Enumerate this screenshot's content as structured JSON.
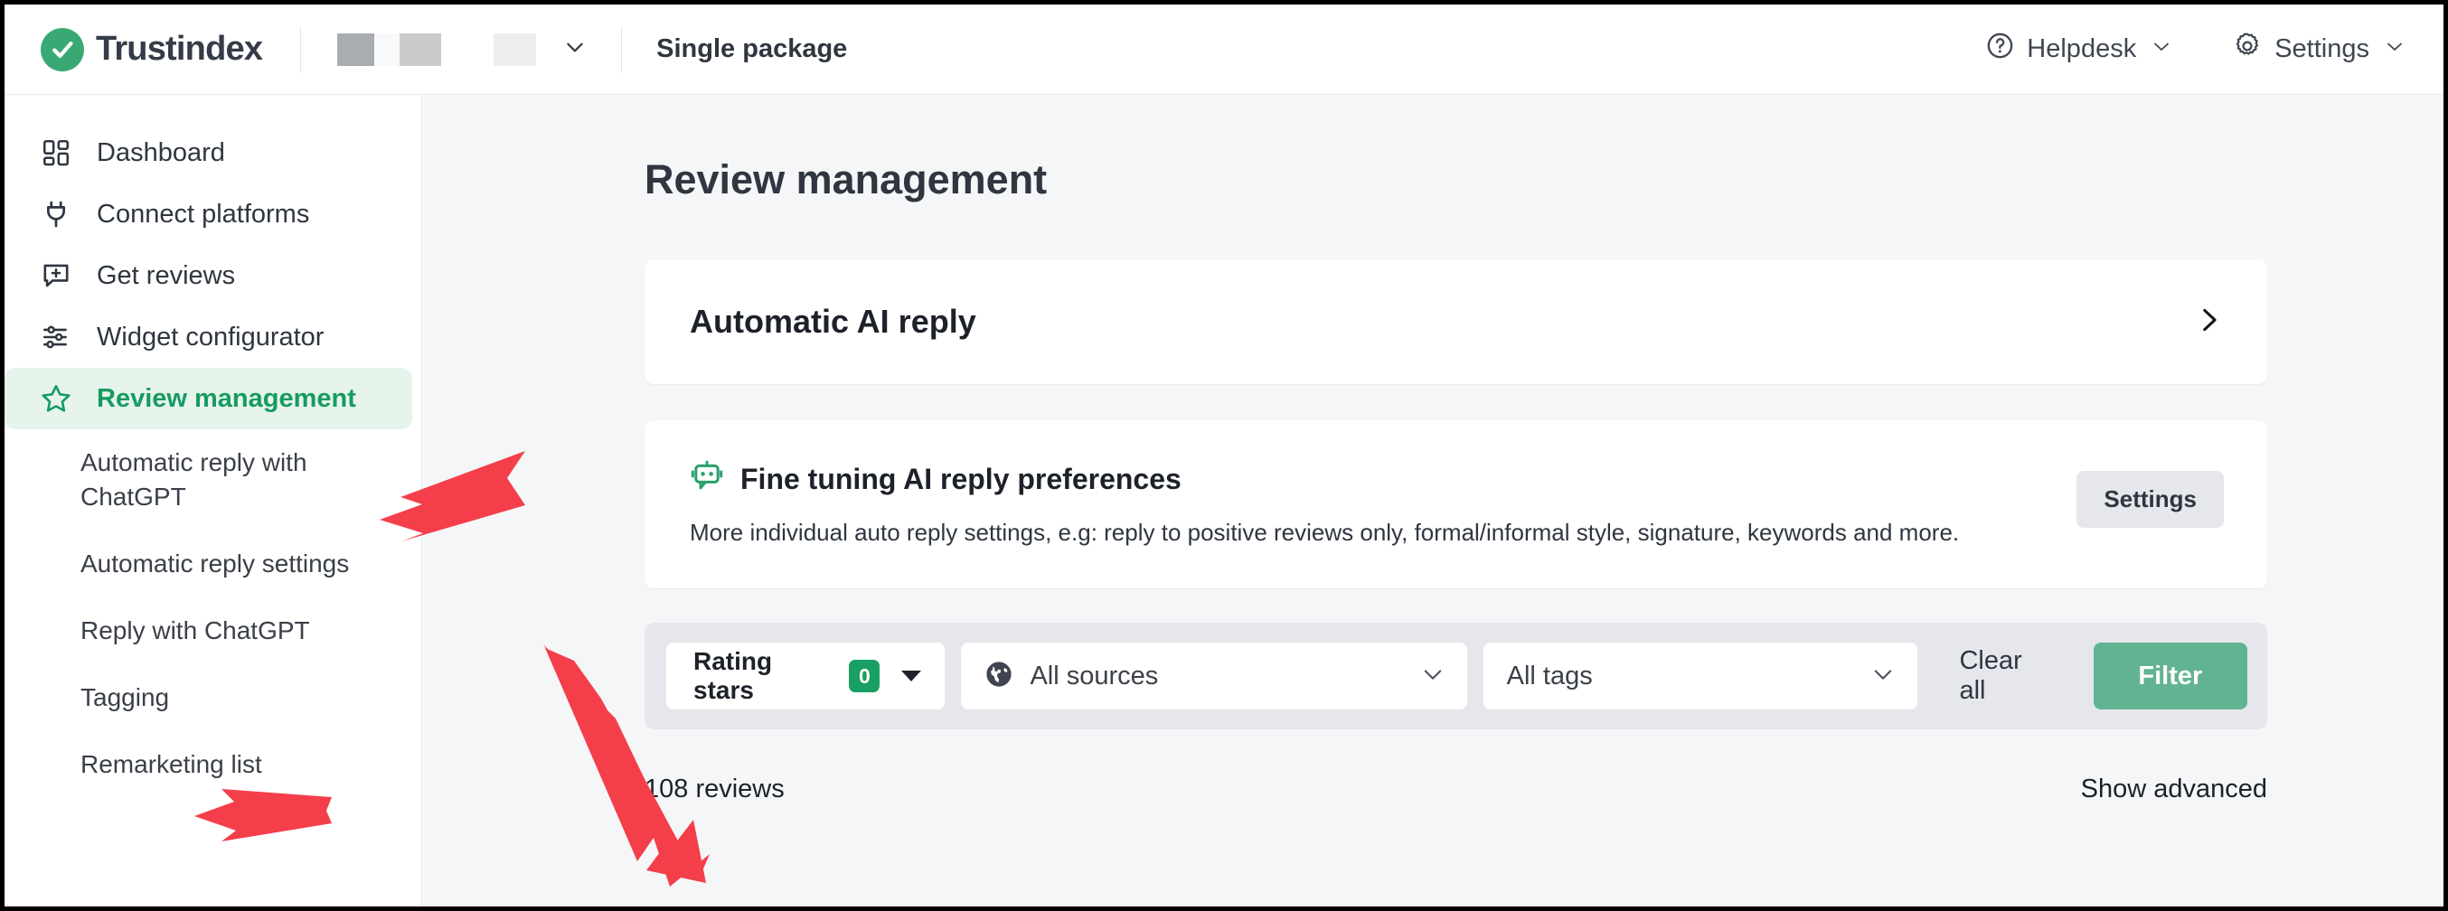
{
  "header": {
    "brand_name": "Trustindex",
    "brand_icon": "check-circle-icon",
    "package_title": "Single package",
    "package_caret_icon": "chevron-down-icon",
    "helpdesk": {
      "label": "Helpdesk",
      "icon": "question-circle-icon",
      "caret_icon": "chevron-down-icon"
    },
    "settings": {
      "label": "Settings",
      "icon": "gear-icon",
      "caret_icon": "chevron-down-icon"
    }
  },
  "sidebar": {
    "items": [
      {
        "label": "Dashboard",
        "icon": "grid-icon",
        "active": false
      },
      {
        "label": "Connect platforms",
        "icon": "plug-icon",
        "active": false
      },
      {
        "label": "Get reviews",
        "icon": "message-plus-icon",
        "active": false
      },
      {
        "label": "Widget configurator",
        "icon": "sliders-icon",
        "active": false
      },
      {
        "label": "Review management",
        "icon": "star-icon",
        "active": true
      }
    ],
    "subitems": [
      {
        "label": "Automatic reply with ChatGPT"
      },
      {
        "label": "Automatic reply settings"
      },
      {
        "label": "Reply with ChatGPT"
      },
      {
        "label": "Tagging"
      },
      {
        "label": "Remarketing list"
      }
    ]
  },
  "main": {
    "page_title": "Review management",
    "ai_reply_card": {
      "title": "Automatic AI reply",
      "chevron_icon": "chevron-right-icon"
    },
    "fine_tuning_card": {
      "icon": "robot-chat-icon",
      "title": "Fine tuning AI reply preferences",
      "description": "More individual auto reply settings, e.g: reply to positive reviews only, formal/informal style, signature, keywords and more.",
      "settings_button": "Settings"
    },
    "filters": {
      "rating": {
        "label": "Rating stars",
        "count": "0",
        "caret_icon": "caret-down-icon"
      },
      "sources": {
        "value": "All sources",
        "icon": "globe-icon",
        "chevron_icon": "chevron-down-icon"
      },
      "tags": {
        "value": "All tags",
        "chevron_icon": "chevron-down-icon"
      },
      "clear_all": "Clear all",
      "filter_button": "Filter"
    },
    "results": {
      "reviews_count": "108 reviews",
      "show_advanced": "Show advanced"
    }
  },
  "annotations": {
    "arrow_color": "#f43f4a",
    "arrows": [
      {
        "name": "arrow-to-review-management"
      },
      {
        "name": "arrow-to-tagging"
      },
      {
        "name": "arrow-to-reviews-count"
      }
    ]
  },
  "colors": {
    "brand_green": "#3aa873",
    "active_green": "#169b62",
    "active_bg": "#e6f4ec",
    "filter_button": "#62b391",
    "badge_green": "#1a9f63",
    "main_bg": "#f5f6f8",
    "filterbar_bg": "#e6e7ec"
  }
}
